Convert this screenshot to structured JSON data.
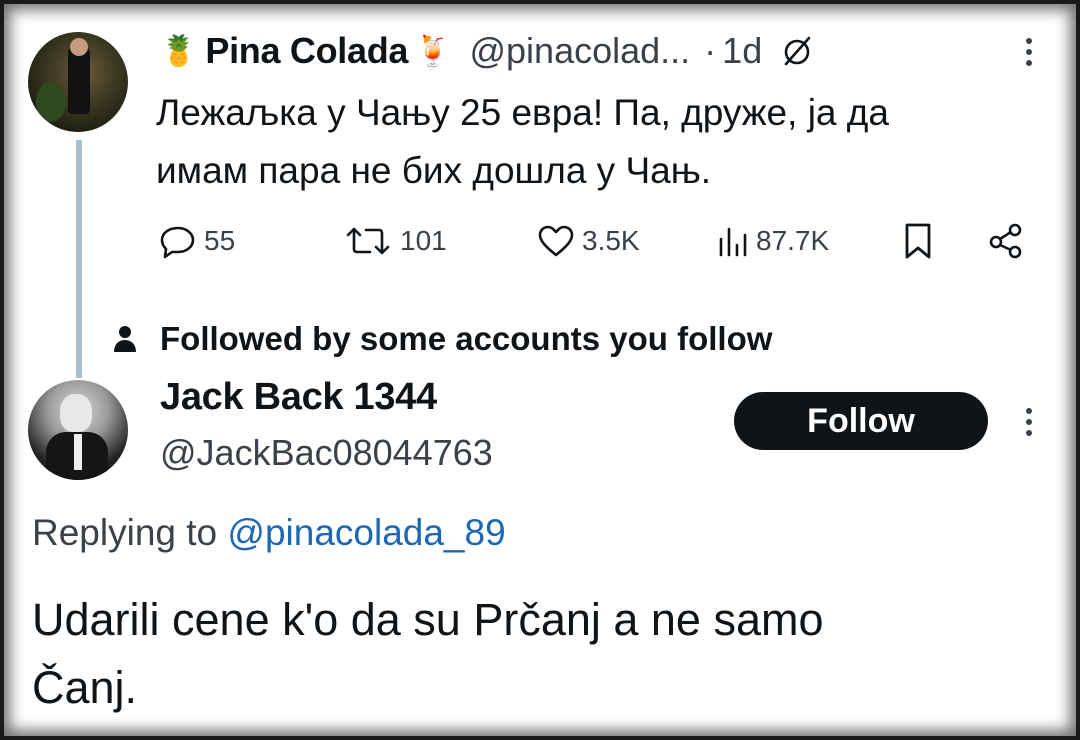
{
  "tweet": {
    "author": {
      "emoji_left": "🍍",
      "display_name": "Pina Colada",
      "emoji_right": "🍹",
      "handle": "@pinacolad...",
      "separator": "·",
      "timestamp": "1d"
    },
    "text_line1": "Лежаљка у Чању 25 евра! Па, друже, ја да",
    "text_line2": "имам пара не бих дошла у Чањ.",
    "stats": {
      "replies": "55",
      "reposts": "101",
      "likes": "3.5K",
      "views": "87.7K"
    },
    "icons": [
      "reply-icon",
      "repost-icon",
      "like-icon",
      "views-icon",
      "bookmark-icon",
      "share-icon",
      "slash-icon",
      "more-icon"
    ]
  },
  "social_context": {
    "text": "Followed by some accounts you follow",
    "icon": "person-icon"
  },
  "reply": {
    "author": {
      "display_name": "Jack Back 1344",
      "handle": "@JackBac08044763"
    },
    "follow_label": "Follow",
    "replying_prefix": "Replying to",
    "replying_handle": "@pinacolada_89",
    "text_line1": "Udarili cene k'o da su Prčanj a ne samo",
    "text_line2": "Čanj."
  },
  "colors": {
    "text": "#0f1419",
    "secondary": "#3b4148",
    "link": "#1d68b4",
    "thread_line": "#a9bfcc",
    "button_bg": "#0f1419",
    "button_text": "#ffffff"
  }
}
